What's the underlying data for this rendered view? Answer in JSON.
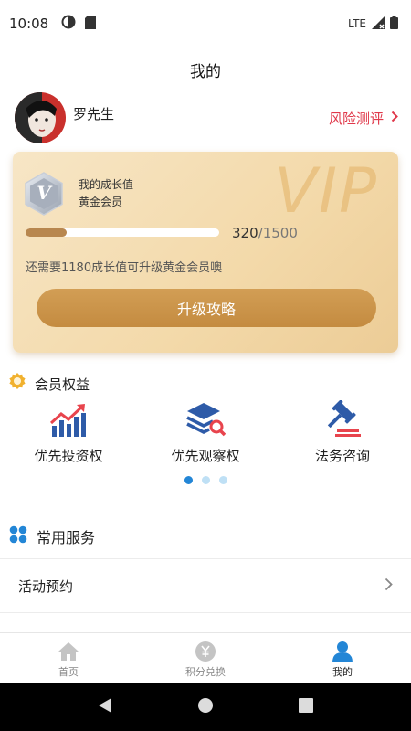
{
  "status_bar": {
    "time": "10:08",
    "network": "LTE"
  },
  "header": {
    "title": "我的"
  },
  "user": {
    "name": "罗先生",
    "risk_link": "风险测评"
  },
  "vip_card": {
    "watermark": "VIP",
    "badge_letter": "V",
    "growth_label": "我的成长值",
    "tier": "黄金会员",
    "progress_current": "320",
    "progress_total": "/1500",
    "progress_fraction": 0.213,
    "upgrade_hint": "还需要1180成长值可升级黄金会员噢",
    "upgrade_button": "升级攻略"
  },
  "benefits": {
    "title": "会员权益",
    "items": [
      {
        "label": "优先投资权",
        "icon": "growth-chart-icon"
      },
      {
        "label": "优先观察权",
        "icon": "layers-search-icon"
      },
      {
        "label": "法务咨询",
        "icon": "gavel-icon"
      }
    ],
    "page_count": 3,
    "active_page": 0
  },
  "services": {
    "title": "常用服务",
    "items": [
      {
        "label": "活动预约"
      }
    ]
  },
  "tabbar": {
    "tabs": [
      {
        "label": "首页",
        "icon": "home-icon",
        "active": false
      },
      {
        "label": "积分兑换",
        "icon": "yen-coin-icon",
        "active": false
      },
      {
        "label": "我的",
        "icon": "person-icon",
        "active": true
      }
    ]
  },
  "colors": {
    "accent_red": "#e0384a",
    "gold": "#c48b40",
    "blue": "#2386d6"
  }
}
